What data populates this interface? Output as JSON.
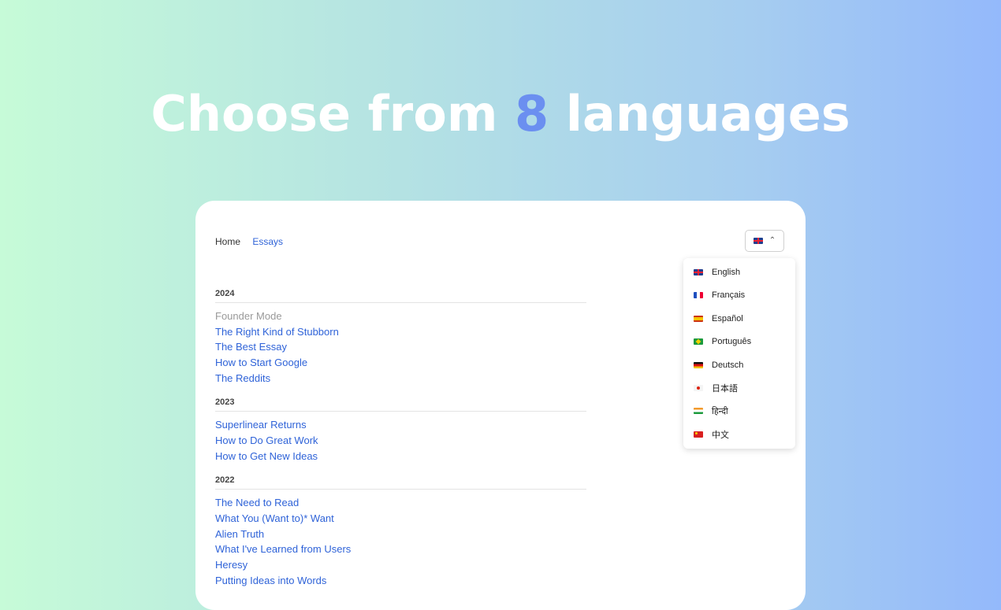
{
  "hero": {
    "prefix": "Choose from ",
    "number": "8",
    "suffix": " languages"
  },
  "nav": {
    "home": "Home",
    "essays": "Essays"
  },
  "language_button": {
    "flag_icon": "gb-flag-icon",
    "chevron_icon": "chevron-up-icon"
  },
  "languages": [
    {
      "label": "English",
      "flag": "gb"
    },
    {
      "label": "Français",
      "flag": "fr"
    },
    {
      "label": "Español",
      "flag": "es"
    },
    {
      "label": "Português",
      "flag": "br"
    },
    {
      "label": "Deutsch",
      "flag": "de"
    },
    {
      "label": "日本語",
      "flag": "jp"
    },
    {
      "label": "हिन्दी",
      "flag": "in"
    },
    {
      "label": "中文",
      "flag": "cn"
    }
  ],
  "sections": [
    {
      "year": "2024",
      "essays": [
        "Founder Mode",
        "The Right Kind of Stubborn",
        "The Best Essay",
        "How to Start Google",
        "The Reddits"
      ]
    },
    {
      "year": "2023",
      "essays": [
        "Superlinear Returns",
        "How to Do Great Work",
        "How to Get New Ideas"
      ]
    },
    {
      "year": "2022",
      "essays": [
        "The Need to Read",
        "What You (Want to)* Want",
        "Alien Truth",
        "What I've Learned from Users",
        "Heresy",
        "Putting Ideas into Words"
      ]
    }
  ],
  "colors": {
    "accent": "#2f63d8",
    "hero_number": "#6b8ff0",
    "muted": "#999999"
  }
}
